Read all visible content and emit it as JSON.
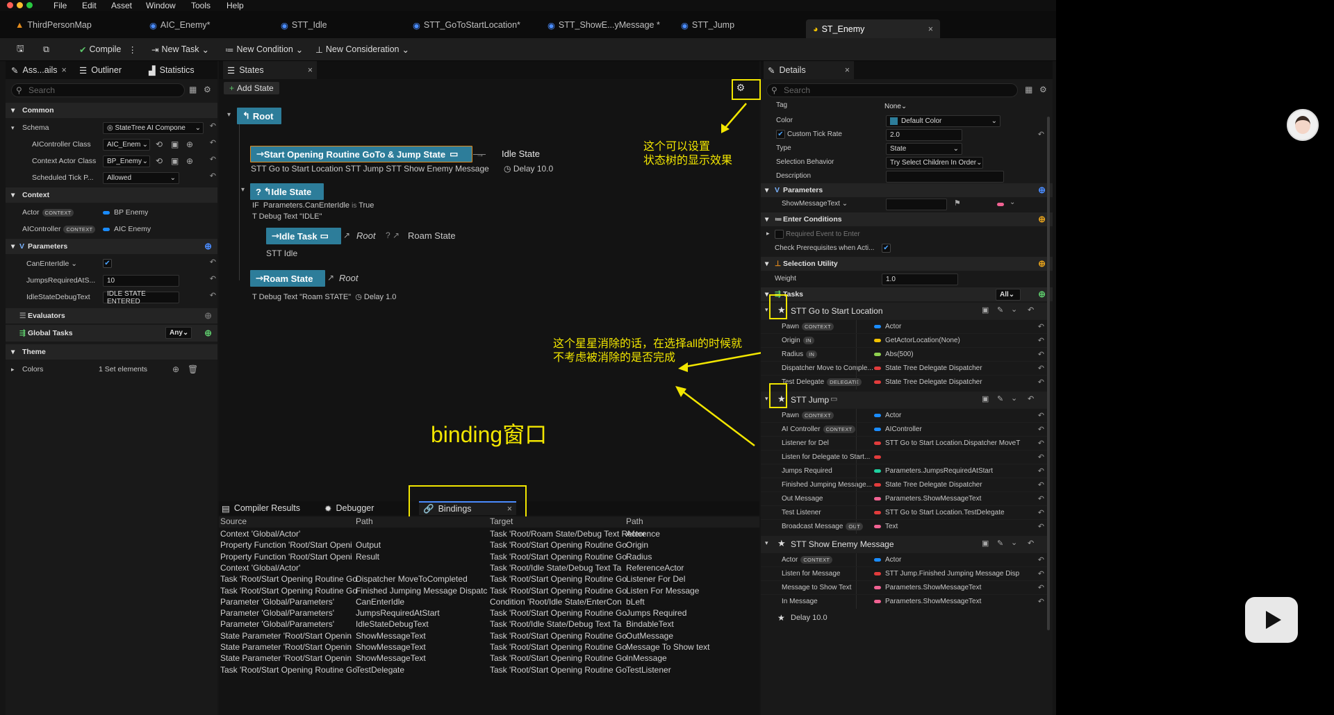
{
  "menu": [
    "File",
    "Edit",
    "Asset",
    "Window",
    "Tools",
    "Help"
  ],
  "doc_tabs": [
    "ThirdPersonMap",
    "AIC_Enemy*",
    "STT_Idle",
    "STT_GoToStartLocation*",
    "STT_ShowE...yMessage *",
    "STT_Jump",
    "ST_Enemy"
  ],
  "toolbar": {
    "save": "",
    "compile": "Compile",
    "new_task": "New Task",
    "new_condition": "New Condition",
    "new_consideration": "New Consideration"
  },
  "left_panel": {
    "tabs": [
      "Ass...ails",
      "Outliner",
      "Statistics"
    ],
    "search_placeholder": "Search",
    "common": "Common",
    "schema_label": "Schema",
    "schema_value": "StateTree AI Compone",
    "aicontroller_class_label": "AIController Class",
    "aicontroller_class_value": "AIC_Enem",
    "context_actor_class_label": "Context Actor Class",
    "context_actor_class_value": "BP_Enemy",
    "scheduled_tick_label": "Scheduled Tick P...",
    "scheduled_tick_value": "Allowed",
    "context": "Context",
    "actor_label": "Actor",
    "actor_badge": "CONTEXT",
    "actor_value": "BP Enemy",
    "aicontroller_label": "AIController",
    "aicontroller_badge": "CONTEXT",
    "aicontroller_value": "AIC Enemy",
    "parameters": "Parameters",
    "canenteridle_label": "CanEnterIdle",
    "jumps_label": "JumpsRequiredAtS...",
    "jumps_value": "10",
    "idledebug_label": "IdleStateDebugText",
    "idledebug_value": "IDLE STATE ENTERED",
    "evaluators": "Evaluators",
    "global_tasks": "Global Tasks",
    "global_tasks_value": "Any",
    "theme": "Theme",
    "colors_label": "Colors",
    "colors_value": "1 Set elements"
  },
  "states_panel": {
    "tab": "States",
    "add_state": "Add State",
    "root": "Root",
    "start_node": "Start Opening Routine GoTo & Jump State",
    "start_transition": "Idle State",
    "start_tasks": "STT Go to Start Location   STT Jump   STT Show Enemy Message",
    "start_delay": "Delay 10.0",
    "idle_node": "Idle State",
    "idle_cond_if": "IF",
    "idle_cond": "Parameters.CanEnterIdle",
    "idle_cond_is": "is",
    "idle_cond_val": "True",
    "idle_debug": "Debug Text \"IDLE\"",
    "idle_task_node": "Idle Task",
    "idle_task_root": "Root",
    "idle_task_trans": "Roam State",
    "idle_task_sub": "STT Idle",
    "roam_node": "Roam State",
    "roam_trans": "Root",
    "roam_debug": "Debug Text \"Roam STATE\"",
    "roam_delay": "Delay 1.0"
  },
  "annotations": {
    "settings_note_1": "这个可以设置",
    "settings_note_2": "状态树的显示效果",
    "star_note_1": "这个星星消除的话，在选择all的时候就",
    "star_note_2": "不考虑被消除的是否完成",
    "binding_note": "binding窗口"
  },
  "bottom_panel": {
    "tabs": [
      "Compiler Results",
      "Debugger",
      "Bindings"
    ],
    "columns": [
      "Source",
      "Path",
      "Target",
      "Path"
    ],
    "rows": [
      [
        "Context 'Global/Actor'",
        "",
        "Task 'Root/Roam State/Debug Text Reference",
        "Actor"
      ],
      [
        "Property Function 'Root/Start Openi",
        "Output",
        "Task 'Root/Start Opening Routine Go",
        "Origin"
      ],
      [
        "Property Function 'Root/Start Openi",
        "Result",
        "Task 'Root/Start Opening Routine Go",
        "Radius"
      ],
      [
        "Context 'Global/Actor'",
        "",
        "Task 'Root/Idle State/Debug Text Ta",
        "ReferenceActor"
      ],
      [
        "Task 'Root/Start Opening Routine Go",
        "Dispatcher MoveToCompleted",
        "Task 'Root/Start Opening Routine Go",
        "Listener For Del"
      ],
      [
        "Task 'Root/Start Opening Routine Go",
        "Finished Jumping Message Dispatc",
        "Task 'Root/Start Opening Routine Go",
        "Listen For Message"
      ],
      [
        "Parameter 'Global/Parameters'",
        "CanEnterIdle",
        "Condition 'Root/Idle State/EnterCon",
        "bLeft"
      ],
      [
        "Parameter 'Global/Parameters'",
        "JumpsRequiredAtStart",
        "Task 'Root/Start Opening Routine Go",
        "Jumps Required"
      ],
      [
        "Parameter 'Global/Parameters'",
        "IdleStateDebugText",
        "Task 'Root/Idle State/Debug Text Ta",
        "BindableText"
      ],
      [
        "State Parameter 'Root/Start Openin",
        "ShowMessageText",
        "Task 'Root/Start Opening Routine Go",
        "OutMessage"
      ],
      [
        "State Parameter 'Root/Start Openin",
        "ShowMessageText",
        "Task 'Root/Start Opening Routine Go",
        "Message To Show text"
      ],
      [
        "State Parameter 'Root/Start Openin",
        "ShowMessageText",
        "Task 'Root/Start Opening Routine Go",
        "InMessage"
      ],
      [
        "Task 'Root/Start Opening Routine Go",
        "TestDelegate",
        "Task 'Root/Start Opening Routine Go",
        "TestListener"
      ]
    ]
  },
  "details": {
    "tab": "Details",
    "search_placeholder": "Search",
    "tag_label": "Tag",
    "tag_value": "None",
    "color_label": "Color",
    "color_value": "Default Color",
    "custom_tick_label": "Custom Tick Rate",
    "custom_tick_value": "2.0",
    "type_label": "Type",
    "type_value": "State",
    "selection_label": "Selection Behavior",
    "selection_value": "Try Select Children In Order",
    "description_label": "Description",
    "parameters": "Parameters",
    "showmsg_label": "ShowMessageText",
    "enter_conditions": "Enter Conditions",
    "required_event": "Required Event to Enter",
    "check_prereq": "Check Prerequisites when Acti...",
    "selection_utility": "Selection Utility",
    "weight_label": "Weight",
    "weight_value": "1.0",
    "tasks": "Tasks",
    "tasks_value": "All",
    "task1": "STT Go to Start Location",
    "t1_rows": [
      {
        "k": "Pawn",
        "badge": "CONTEXT",
        "v": "Actor",
        "c": "#1a8cff"
      },
      {
        "k": "Origin",
        "badge": "IN",
        "v": "GetActorLocation(None)",
        "c": "#f2c200"
      },
      {
        "k": "Radius",
        "badge": "IN",
        "v": "Abs(500)",
        "c": "#8fd14f"
      },
      {
        "k": "Dispatcher Move to Comple...",
        "badge": "",
        "v": "State Tree Delegate Dispatcher",
        "c": "#e23c3c"
      },
      {
        "k": "Test Delegate",
        "badge": "DELEGATE",
        "v": "State Tree Delegate Dispatcher",
        "c": "#e23c3c"
      }
    ],
    "task2": "STT Jump",
    "t2_rows": [
      {
        "k": "Pawn",
        "badge": "CONTEXT",
        "v": "Actor",
        "c": "#1a8cff"
      },
      {
        "k": "AI Controller",
        "badge": "CONTEXT",
        "v": "AIController",
        "c": "#1a8cff"
      },
      {
        "k": "Listener for Del",
        "badge": "",
        "v": "STT Go to Start Location.Dispatcher MoveT",
        "c": "#e23c3c"
      },
      {
        "k": "Listen for Delegate to Start...",
        "badge": "",
        "v": "",
        "c": "#e23c3c"
      },
      {
        "k": "Jumps Required",
        "badge": "",
        "v": "Parameters.JumpsRequiredAtStart",
        "c": "#1fd1a0"
      },
      {
        "k": "Finished Jumping Message...",
        "badge": "",
        "v": "State Tree Delegate Dispatcher",
        "c": "#e23c3c"
      },
      {
        "k": "Out Message",
        "badge": "",
        "v": "Parameters.ShowMessageText",
        "c": "#f06292"
      },
      {
        "k": "Test Listener",
        "badge": "",
        "v": "STT Go to Start Location.TestDelegate",
        "c": "#e23c3c"
      },
      {
        "k": "Broadcast Message",
        "badge": "OUT",
        "v": "Text",
        "c": "#f06292"
      }
    ],
    "task3": "STT Show Enemy Message",
    "t3_rows": [
      {
        "k": "Actor",
        "badge": "CONTEXT",
        "v": "Actor",
        "c": "#1a8cff"
      },
      {
        "k": "Listen for Message",
        "badge": "",
        "v": "STT Jump.Finished Jumping Message Disp",
        "c": "#e23c3c"
      },
      {
        "k": "Message to Show Text",
        "badge": "",
        "v": "Parameters.ShowMessageText",
        "c": "#f06292"
      },
      {
        "k": "In Message",
        "badge": "",
        "v": "Parameters.ShowMessageText",
        "c": "#f06292"
      }
    ],
    "delay_row": "Delay 10.0"
  }
}
